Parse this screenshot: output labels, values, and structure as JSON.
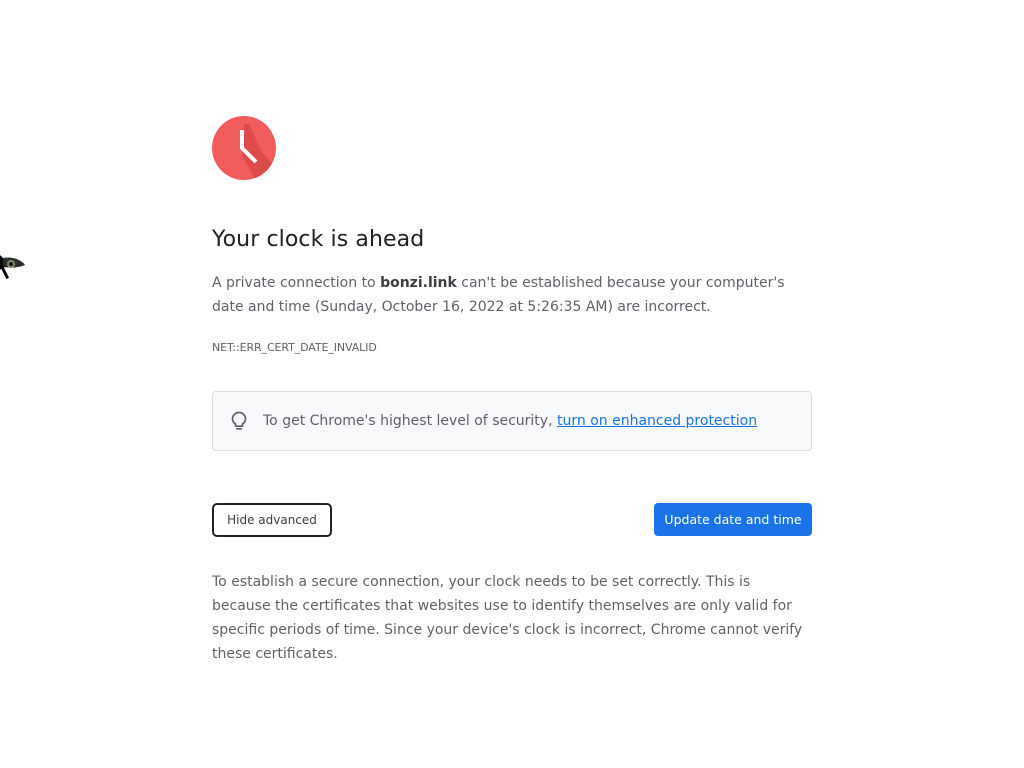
{
  "heading": "Your clock is ahead",
  "main_message": {
    "prefix": "A private connection to ",
    "domain": "bonzi.link",
    "suffix": " can't be established because your computer's date and time (Sunday, October 16, 2022 at 5:26:35 AM) are incorrect."
  },
  "error_code": "NET::ERR_CERT_DATE_INVALID",
  "enhanced_protection": {
    "text": "To get Chrome's highest level of security, ",
    "link_label": "turn on enhanced protection"
  },
  "buttons": {
    "hide_advanced": "Hide advanced",
    "update_date_time": "Update date and time"
  },
  "details_text": "To establish a secure connection, your clock needs to be set correctly. This is because the certificates that websites use to identify themselves are only valid for specific periods of time. Since your device's clock is incorrect, Chrome cannot verify these certificates.",
  "icons": {
    "clock": "clock-icon",
    "bulb": "lightbulb-icon",
    "cursor": "mouse-cursor-icon"
  },
  "colors": {
    "clock_red": "#f35c5c",
    "primary_blue": "#1a73e8",
    "link_blue": "#1a73e8",
    "box_background": "#f8f9fa"
  }
}
